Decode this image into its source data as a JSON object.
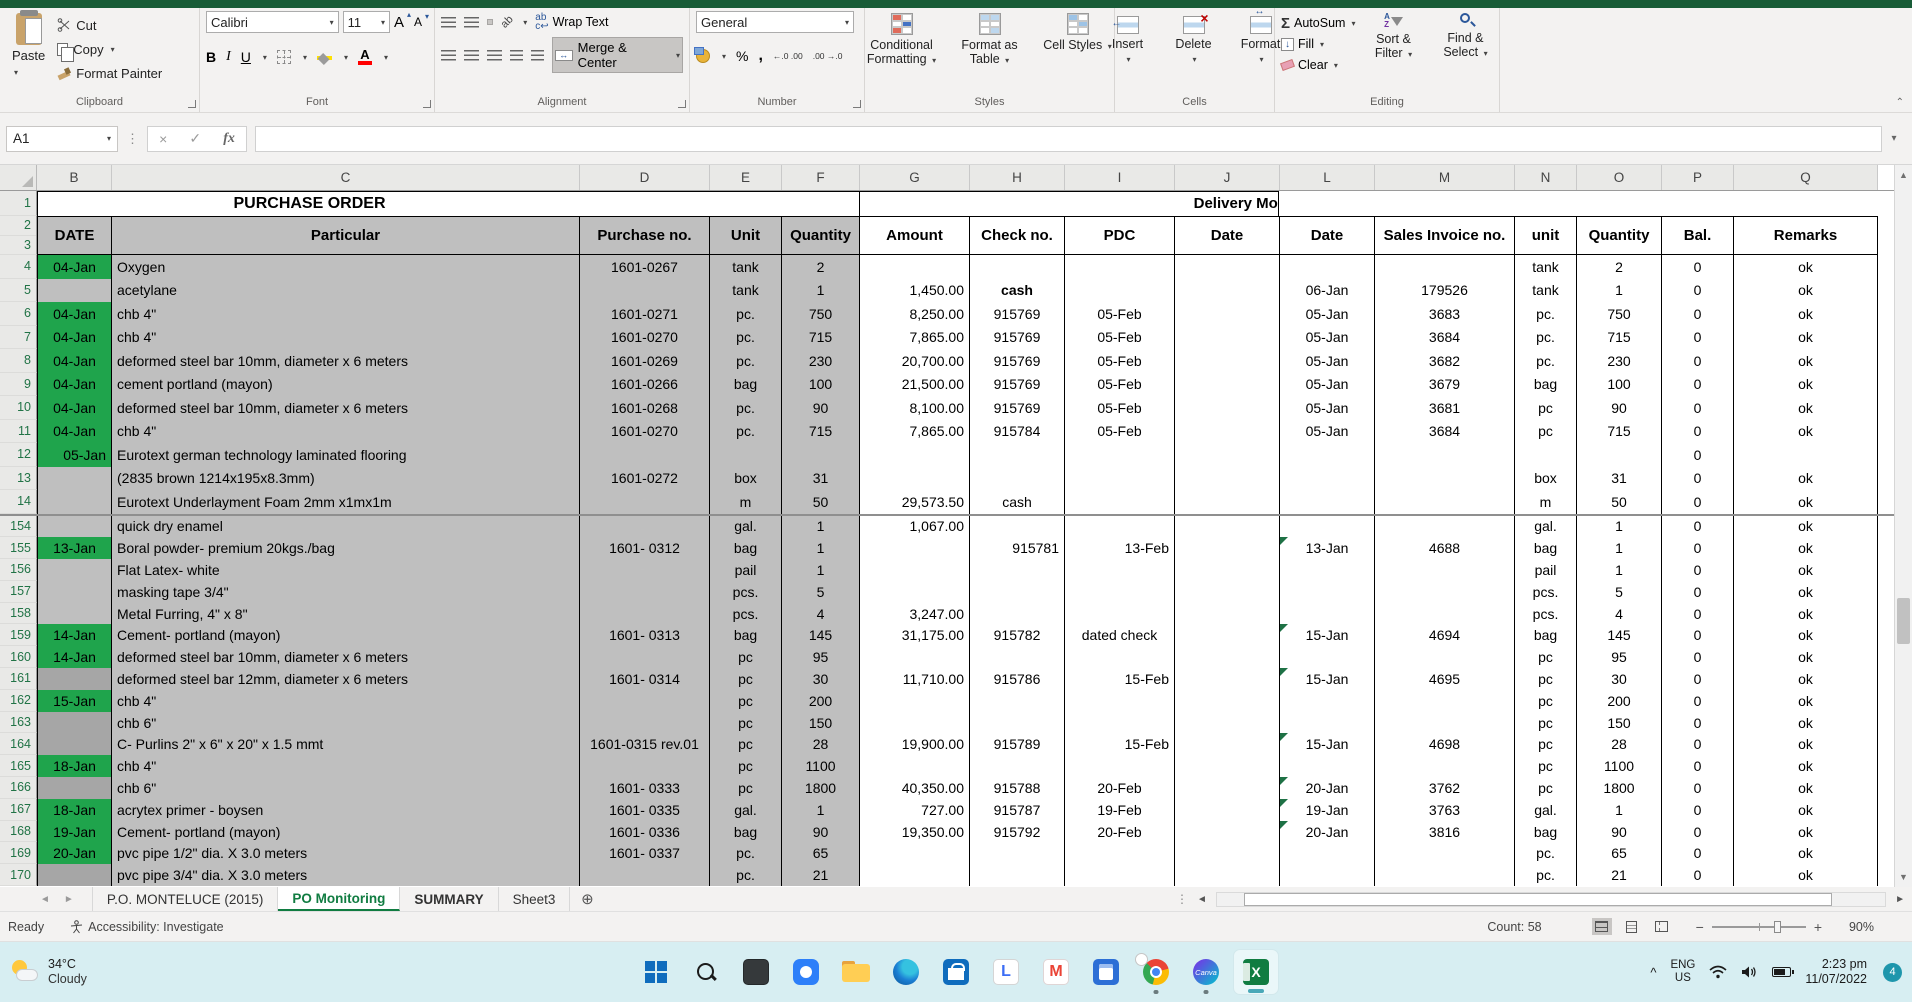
{
  "colors": {
    "excel_green": "#107C41",
    "title_strip_green": "#185C37",
    "date_cell_green": "#1FA44C",
    "gray_fill": "#BFBFBF",
    "dark_gray_fill": "#A6A6A6",
    "flag_green": "#1E7145",
    "taskbar_bg": "#D7EEF2"
  },
  "ribbon": {
    "groups": [
      "Clipboard",
      "Font",
      "Alignment",
      "Number",
      "Styles",
      "Cells",
      "Editing"
    ],
    "clipboard": {
      "paste": "Paste",
      "cut": "Cut",
      "copy": "Copy",
      "format_painter": "Format Painter"
    },
    "font": {
      "family": "Calibri",
      "size": "11",
      "bold": "B",
      "italic": "I",
      "underline": "U"
    },
    "alignment": {
      "wrap_text": "Wrap Text",
      "merge_center": "Merge & Center",
      "orientation": "ab"
    },
    "number": {
      "format": "General",
      "percent": "%",
      "comma": ",",
      "inc_dec": "←.0 .00",
      "dec_dec": ".00 →.0"
    },
    "styles": {
      "conditional_formatting": "Conditional Formatting",
      "format_as_table": "Format as Table",
      "cell_styles": "Cell Styles"
    },
    "cells": {
      "insert": "Insert",
      "delete": "Delete",
      "format": "Format"
    },
    "editing": {
      "autosum": "AutoSum",
      "fill": "Fill",
      "clear": "Clear",
      "sort_filter": "Sort & Filter",
      "find_select": "Find & Select"
    }
  },
  "formula_bar": {
    "name_box": "A1",
    "fx_label": "fx",
    "value": ""
  },
  "sheet": {
    "column_letters": [
      "B",
      "C",
      "D",
      "E",
      "F",
      "G",
      "H",
      "I",
      "J",
      "L",
      "M",
      "N",
      "O",
      "P",
      "Q"
    ],
    "title": "PURCHASE ORDER",
    "delivery_title": "Delivery Mon",
    "headers": [
      "DATE",
      "Particular",
      "Purchase no.",
      "Unit",
      "Quantity",
      "Amount",
      "Check no.",
      "PDC",
      "Date",
      "Date",
      "Sales Invoice no.",
      "unit",
      "Quantity",
      "Bal.",
      "Remarks"
    ],
    "top_rows": [
      {
        "n": 4,
        "c": [
          {
            "v": "04-Jan",
            "s": "g"
          },
          "Oxygen",
          "1601-0267",
          "tank",
          "2",
          "",
          "",
          "",
          "",
          "",
          "",
          "tank",
          "2",
          "0",
          "ok"
        ]
      },
      {
        "n": 5,
        "c": [
          "",
          "acetylane",
          "",
          "tank",
          "1",
          "1,450.00",
          {
            "v": "cash",
            "s": "b"
          },
          "",
          "",
          "06-Jan",
          "179526",
          "tank",
          "1",
          "0",
          "ok"
        ]
      },
      {
        "n": 6,
        "c": [
          {
            "v": "04-Jan",
            "s": "g"
          },
          "chb 4\"",
          "1601-0271",
          "pc.",
          "750",
          "8,250.00",
          "915769",
          "05-Feb",
          "",
          "05-Jan",
          "3683",
          "pc.",
          "750",
          "0",
          "ok"
        ]
      },
      {
        "n": 7,
        "c": [
          {
            "v": "04-Jan",
            "s": "g"
          },
          "chb 4\"",
          "1601-0270",
          "pc.",
          "715",
          "7,865.00",
          "915769",
          "05-Feb",
          "",
          "05-Jan",
          "3684",
          "pc.",
          "715",
          "0",
          "ok"
        ]
      },
      {
        "n": 8,
        "c": [
          {
            "v": "04-Jan",
            "s": "g"
          },
          "deformed steel bar 10mm, diameter x 6 meters",
          "1601-0269",
          "pc.",
          "230",
          "20,700.00",
          "915769",
          "05-Feb",
          "",
          "05-Jan",
          "3682",
          "pc.",
          "230",
          "0",
          "ok"
        ]
      },
      {
        "n": 9,
        "c": [
          {
            "v": "04-Jan",
            "s": "g"
          },
          "cement portland (mayon)",
          "1601-0266",
          "bag",
          "100",
          "21,500.00",
          "915769",
          "05-Feb",
          "",
          "05-Jan",
          "3679",
          "bag",
          "100",
          "0",
          "ok"
        ]
      },
      {
        "n": 10,
        "c": [
          {
            "v": "04-Jan",
            "s": "g"
          },
          "deformed steel bar 10mm, diameter x 6 meters",
          "1601-0268",
          "pc.",
          "90",
          "8,100.00",
          "915769",
          "05-Feb",
          "",
          "05-Jan",
          "3681",
          "pc",
          "90",
          "0",
          "ok"
        ]
      },
      {
        "n": 11,
        "c": [
          {
            "v": "04-Jan",
            "s": "g"
          },
          "chb 4\"",
          "1601-0270",
          "pc.",
          "715",
          "7,865.00",
          "915784",
          "05-Feb",
          "",
          "05-Jan",
          "3684",
          "pc",
          "715",
          "0",
          "ok"
        ]
      },
      {
        "n": 12,
        "c": [
          {
            "v": "05-Jan",
            "s": "g r"
          },
          "Eurotext german technology laminated flooring",
          "",
          "",
          "",
          "",
          "",
          "",
          "",
          "",
          "",
          "",
          "",
          "0",
          ""
        ]
      },
      {
        "n": 13,
        "c": [
          "",
          "(2835 brown 1214x195x8.3mm)",
          "1601-0272",
          "box",
          "31",
          "",
          "",
          "",
          "",
          "",
          "",
          "box",
          "31",
          "0",
          "ok"
        ]
      },
      {
        "n": 14,
        "c": [
          "",
          "Eurotext Underlayment Foam 2mm x1mx1m",
          "",
          "m",
          "50",
          "29,573.50",
          "cash",
          "",
          "",
          "",
          "",
          "m",
          "50",
          "0",
          "ok"
        ]
      }
    ],
    "bottom_rows": [
      {
        "n": 154,
        "c": [
          "",
          "quick dry enamel",
          "",
          "gal.",
          "1",
          "1,067.00",
          "",
          "",
          "",
          "",
          "",
          "gal.",
          "1",
          "0",
          "ok"
        ]
      },
      {
        "n": 155,
        "c": [
          {
            "v": "13-Jan",
            "s": "g"
          },
          "Boral powder- premium 20kgs./bag",
          "1601- 0312",
          "bag",
          "1",
          "",
          {
            "v": "915781",
            "s": "r"
          },
          {
            "v": "13-Feb",
            "s": "r"
          },
          "",
          {
            "v": "13-Jan",
            "s": "f"
          },
          "4688",
          "bag",
          "1",
          "0",
          "ok"
        ]
      },
      {
        "n": 156,
        "c": [
          "",
          "Flat Latex- white",
          "",
          "pail",
          "1",
          "",
          "",
          "",
          "",
          "",
          "",
          "pail",
          "1",
          "0",
          "ok"
        ]
      },
      {
        "n": 157,
        "c": [
          "",
          "masking tape 3/4\"",
          "",
          "pcs.",
          "5",
          "",
          "",
          "",
          "",
          "",
          "",
          "pcs.",
          "5",
          "0",
          "ok"
        ]
      },
      {
        "n": 158,
        "c": [
          "",
          "Metal Furring, 4\" x 8\"",
          "",
          "pcs.",
          "4",
          "3,247.00",
          "",
          "",
          "",
          "",
          "",
          "pcs.",
          "4",
          "0",
          "ok"
        ]
      },
      {
        "n": 159,
        "c": [
          {
            "v": "14-Jan",
            "s": "g"
          },
          "Cement- portland (mayon)",
          "1601- 0313",
          "bag",
          "145",
          "31,175.00",
          "915782",
          "dated check",
          "",
          {
            "v": "15-Jan",
            "s": "f"
          },
          "4694",
          "bag",
          "145",
          "0",
          "ok"
        ]
      },
      {
        "n": 160,
        "c": [
          {
            "v": "14-Jan",
            "s": "g"
          },
          "deformed steel bar 10mm, diameter x 6 meters",
          "",
          "pc",
          "95",
          "",
          "",
          "",
          "",
          "",
          "",
          "pc",
          "95",
          "0",
          "ok"
        ]
      },
      {
        "n": 161,
        "c": [
          {
            "v": "",
            "s": "k"
          },
          "deformed steel bar 12mm, diameter x 6 meters",
          "1601- 0314",
          "pc",
          "30",
          "11,710.00",
          "915786",
          {
            "v": "15-Feb",
            "s": "r"
          },
          "",
          {
            "v": "15-Jan",
            "s": "f"
          },
          "4695",
          "pc",
          "30",
          "0",
          "ok"
        ]
      },
      {
        "n": 162,
        "c": [
          {
            "v": "15-Jan",
            "s": "g"
          },
          "chb 4\"",
          "",
          "pc",
          "200",
          "",
          "",
          "",
          "",
          "",
          "",
          "pc",
          "200",
          "0",
          "ok"
        ]
      },
      {
        "n": 163,
        "c": [
          {
            "v": "",
            "s": "k"
          },
          "chb 6\"",
          "",
          "pc",
          "150",
          "",
          "",
          "",
          "",
          "",
          "",
          "pc",
          "150",
          "0",
          "ok"
        ]
      },
      {
        "n": 164,
        "c": [
          {
            "v": "",
            "s": "k"
          },
          "C- Purlins 2\" x 6\" x 20\" x 1.5 mmt",
          "1601-0315 rev.01",
          "pc",
          "28",
          "19,900.00",
          "915789",
          {
            "v": "15-Feb",
            "s": "r"
          },
          "",
          {
            "v": "15-Jan",
            "s": "f"
          },
          "4698",
          "pc",
          "28",
          "0",
          "ok"
        ]
      },
      {
        "n": 165,
        "c": [
          {
            "v": "18-Jan",
            "s": "g"
          },
          "chb 4\"",
          "",
          "pc",
          "1100",
          "",
          "",
          "",
          "",
          "",
          "",
          "pc",
          "1100",
          "0",
          "ok"
        ]
      },
      {
        "n": 166,
        "c": [
          {
            "v": "",
            "s": "k"
          },
          "chb 6\"",
          "1601- 0333",
          "pc",
          "1800",
          "40,350.00",
          "915788",
          "20-Feb",
          "",
          {
            "v": "20-Jan",
            "s": "f"
          },
          "3762",
          "pc",
          "1800",
          "0",
          "ok"
        ]
      },
      {
        "n": 167,
        "c": [
          {
            "v": "18-Jan",
            "s": "g"
          },
          "acrytex primer - boysen",
          "1601- 0335",
          "gal.",
          "1",
          "727.00",
          "915787",
          "19-Feb",
          "",
          {
            "v": "19-Jan",
            "s": "f"
          },
          "3763",
          "gal.",
          "1",
          "0",
          "ok"
        ]
      },
      {
        "n": 168,
        "c": [
          {
            "v": "19-Jan",
            "s": "g"
          },
          "Cement- portland (mayon)",
          "1601- 0336",
          "bag",
          "90",
          "19,350.00",
          "915792",
          "20-Feb",
          "",
          {
            "v": "20-Jan",
            "s": "f"
          },
          "3816",
          "bag",
          "90",
          "0",
          "ok"
        ]
      },
      {
        "n": 169,
        "c": [
          {
            "v": "20-Jan",
            "s": "g"
          },
          "pvc pipe 1/2\" dia. X 3.0 meters",
          "1601- 0337",
          "pc.",
          "65",
          "",
          "",
          "",
          "",
          "",
          "",
          "pc.",
          "65",
          "0",
          "ok"
        ]
      },
      {
        "n": 170,
        "c": [
          {
            "v": "",
            "s": "k"
          },
          "pvc pipe 3/4\" dia. X 3.0 meters",
          "",
          "pc.",
          "21",
          "",
          "",
          "",
          "",
          "",
          "",
          "pc.",
          "21",
          "0",
          "ok"
        ]
      }
    ]
  },
  "tabs": {
    "sheet_tabs": [
      {
        "label": "P.O. MONTELUCE (2015)"
      },
      {
        "label": "PO Monitoring"
      },
      {
        "label": "SUMMARY"
      },
      {
        "label": "Sheet3"
      }
    ]
  },
  "status": {
    "mode": "Ready",
    "accessibility": "Accessibility: Investigate",
    "count": "Count: 58",
    "zoom": "90%"
  },
  "taskbar": {
    "weather_temp": "34°C",
    "weather_desc": "Cloudy",
    "lightshot_letter": "L",
    "gmail_letter": "M",
    "canva_label": "Canva",
    "excel_letter": "X",
    "lang_top": "ENG",
    "lang_bottom": "US",
    "time": "2:23 pm",
    "date": "11/07/2022",
    "badge": "4"
  }
}
